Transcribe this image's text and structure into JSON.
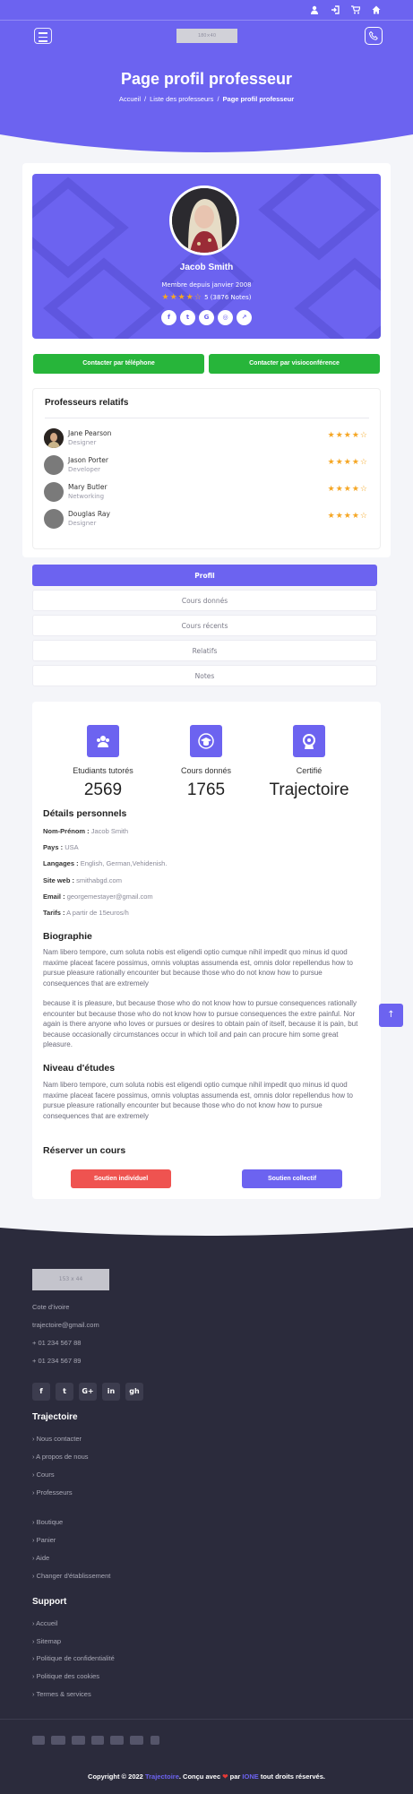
{
  "header": {
    "logo_placeholder": "180×40",
    "title": "Page profil professeur",
    "breadcrumb": [
      "Accueil",
      "Liste des professeurs",
      "Page profil professeur"
    ],
    "top_icons": [
      "user-icon",
      "sign-in-icon",
      "cart-icon",
      "home-icon"
    ]
  },
  "profile": {
    "name": "Jacob Smith",
    "since": "Membre depuis janvier 2008",
    "rating_text": "5 (3876 Notes)",
    "rating_stars": 4,
    "social": [
      "f",
      "t",
      "G",
      "◎",
      "↗"
    ],
    "btn_phone": "Contacter par téléphone",
    "btn_video": "Contacter par visioconférence"
  },
  "related": {
    "title": "Professeurs relatifs",
    "items": [
      {
        "name": "Jane Pearson",
        "role": "Designer"
      },
      {
        "name": "Jason Porter",
        "role": "Developer"
      },
      {
        "name": "Mary Butler",
        "role": "Networking"
      },
      {
        "name": "Douglas Ray",
        "role": "Designer"
      }
    ],
    "stars": "★★★★☆"
  },
  "tabs": [
    "Profil",
    "Cours donnés",
    "Cours récents",
    "Relatifs",
    "Notes"
  ],
  "stats": [
    {
      "label": "Etudiants tutorés",
      "value": "2569",
      "icon": "users-icon"
    },
    {
      "label": "Cours donnés",
      "value": "1765",
      "icon": "graduation-cap-icon"
    },
    {
      "label": "Certifié",
      "value": "Trajectoire",
      "icon": "certificate-icon"
    }
  ],
  "details": {
    "title": "Détails personnels",
    "rows": [
      {
        "label": "Nom-Prénom :",
        "value": "Jacob Smith"
      },
      {
        "label": "Pays :",
        "value": "USA"
      },
      {
        "label": "Langages :",
        "value": "English, German,Vehidenish."
      },
      {
        "label": "Site web :",
        "value": "smithabgd.com"
      },
      {
        "label": "Email :",
        "value": "georgemestayer@gmail.com"
      },
      {
        "label": "Tarifs :",
        "value": "A partir de 15euros/h"
      }
    ]
  },
  "bio": {
    "title": "Biographie",
    "p1": "Nam libero tempore, cum soluta nobis est eligendi optio cumque nihil impedit quo minus id quod maxime placeat facere possimus, omnis voluptas assumenda est, omnis dolor repellendus how to pursue pleasure rationally encounter but because those who do not know how to pursue consequences that are extremely",
    "p2": "because it is pleasure, but because those who do not know how to pursue consequences rationally encounter but because those who do not know how to pursue consequences the extre painful. Nor again is there anyone who loves or pursues or desires to obtain pain of itself, because it is pain, but because occasionally circumstances occur in which toil and pain can procure him some great pleasure."
  },
  "level": {
    "title": "Niveau d'études",
    "p": "Nam libero tempore, cum soluta nobis est eligendi optio cumque nihil impedit quo minus id quod maxime placeat facere possimus, omnis voluptas assumenda est, omnis dolor repellendus how to pursue pleasure rationally encounter but because those who do not know how to pursue consequences that are extremely"
  },
  "booking": {
    "title": "Réserver un cours",
    "individual": "Soutien individuel",
    "collective": "Soutien collectif"
  },
  "footer": {
    "logo_placeholder": "153 x 44",
    "country": "Cote d'ivoire",
    "email": "trajectoire@gmail.com",
    "phone1": "+ 01 234 567 88",
    "phone2": "+ 01 234 567 89",
    "social": [
      "f",
      "t",
      "G+",
      "in",
      "gh"
    ],
    "col1_title": "Trajectoire",
    "col1": [
      "Nous contacter",
      "A propos de nous",
      "Cours",
      "Professeurs"
    ],
    "col2": [
      "Boutique",
      "Panier",
      "Aide",
      "Changer d'établissement"
    ],
    "col3_title": "Support",
    "col3": [
      "Accueil",
      "Sitemap",
      "Politique de confidentialité",
      "Politique des cookies",
      "Termes & services"
    ],
    "copyright_pre": "Copyright © 2022",
    "brand": "Trajectoire",
    "made": ". Conçu avec",
    "heart": "❤",
    "by": "par",
    "author": "IONE",
    "rights": "tout droits réservés."
  }
}
